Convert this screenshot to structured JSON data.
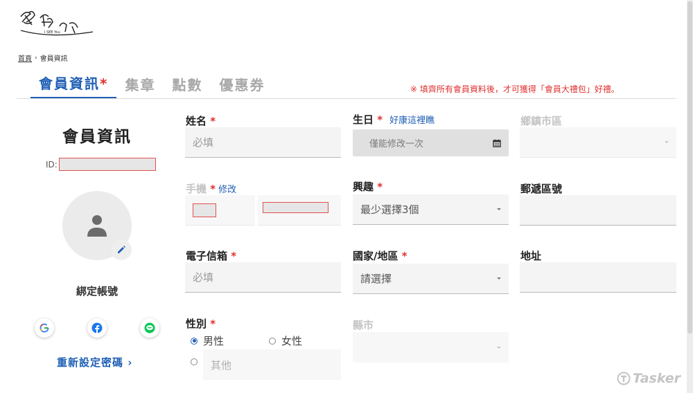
{
  "logo": {
    "text": "愛嬉遊",
    "subtext": "I SEE You"
  },
  "breadcrumb": {
    "home": "首頁",
    "separator": "›",
    "current": "會員資訊"
  },
  "tabs": [
    {
      "label": "會員資訊",
      "star": "*",
      "active": true
    },
    {
      "label": "集章"
    },
    {
      "label": "點數"
    },
    {
      "label": "優惠券"
    }
  ],
  "notice": "※ 填齊所有會員資料後，才可獲得「會員大禮包」好禮。",
  "profile": {
    "title": "會員資訊",
    "id_label": "ID:",
    "bind_title": "綁定帳號",
    "reset_password": "重新設定密碼 ›"
  },
  "form": {
    "name": {
      "label": "姓名",
      "star": "*",
      "placeholder": "必填"
    },
    "birthday": {
      "label": "生日",
      "star": "*",
      "link": "好康這裡瞧",
      "placeholder": "僅能修改一次"
    },
    "district": {
      "label": "鄉鎮市區"
    },
    "phone": {
      "label": "手機",
      "star": "*",
      "link": "修改"
    },
    "interest": {
      "label": "興趣",
      "star": "*",
      "value": "最少選擇3個"
    },
    "postal": {
      "label": "郵遞區號"
    },
    "email": {
      "label": "電子信箱",
      "star": "*",
      "placeholder": "必填"
    },
    "country": {
      "label": "國家/地區",
      "star": "*",
      "value": "請選擇"
    },
    "address": {
      "label": "地址"
    },
    "gender": {
      "label": "性別",
      "star": "*",
      "male": "男性",
      "female": "女性",
      "other": "其他",
      "selected": "male"
    },
    "city": {
      "label": "縣市"
    }
  },
  "watermark": "Tasker",
  "colors": {
    "accent": "#1f5fb5",
    "required": "#e03030",
    "redaction": "#e05050"
  },
  "icons": {
    "calendar": "calendar-icon",
    "user": "user-icon",
    "edit": "pencil-icon",
    "google": "google-icon",
    "facebook": "facebook-icon",
    "line": "line-icon"
  }
}
